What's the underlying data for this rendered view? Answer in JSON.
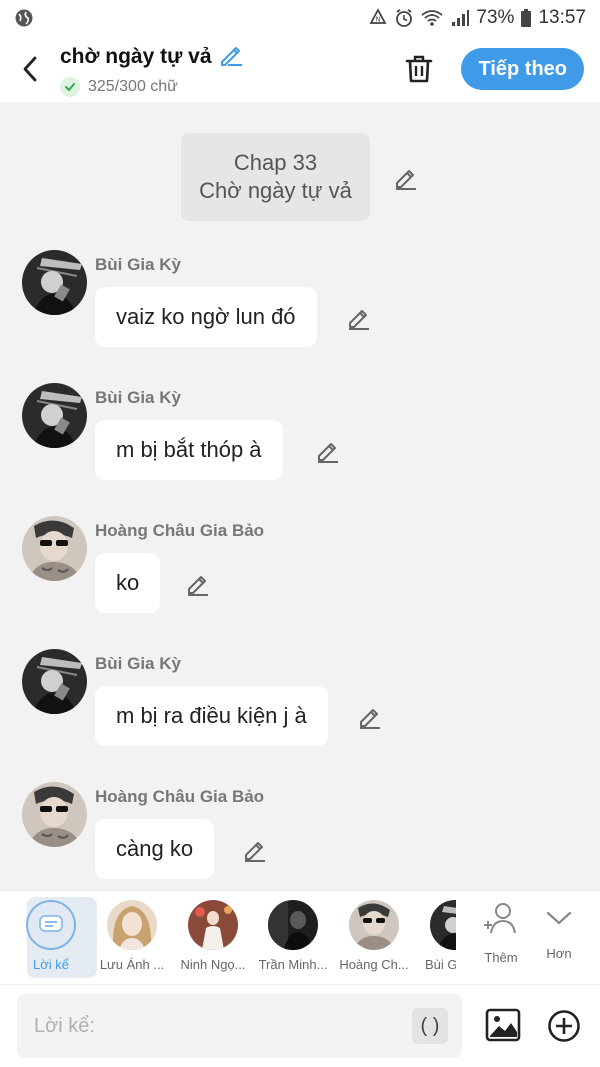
{
  "status_bar": {
    "battery": "73%",
    "time": "13:57"
  },
  "header": {
    "title": "chờ ngày tự vả",
    "word_count": "325/300 chữ",
    "next_label": "Tiếp theo",
    "accent_color": "#3f9be8"
  },
  "chapter": {
    "line1": "Chap 33",
    "line2": "Chờ ngày tự vả"
  },
  "messages": [
    {
      "name": "Bùi Gia Kỳ",
      "text": "vaiz ko ngờ lun đó"
    },
    {
      "name": "Bùi Gia Kỳ",
      "text": "m bị bắt thóp à"
    },
    {
      "name": "Hoàng Châu Gia Bảo",
      "text": "ko"
    },
    {
      "name": "Bùi Gia Kỳ",
      "text": "m bị ra điều kiện j à"
    },
    {
      "name": "Hoàng Châu Gia Bảo",
      "text": "càng ko"
    }
  ],
  "characters": [
    {
      "label": "Lời kể",
      "icon": "narration-icon",
      "selected": true
    },
    {
      "label": "Lưu Ánh ..."
    },
    {
      "label": "Ninh Ngọ..."
    },
    {
      "label": "Trần Minh..."
    },
    {
      "label": "Hoàng Ch..."
    },
    {
      "label": "Bùi G"
    }
  ],
  "char_actions": {
    "add_label": "Thêm",
    "more_label": "Hơn"
  },
  "input": {
    "placeholder": "Lời kể:",
    "paren_label": "( )"
  },
  "icons": [
    "back-icon",
    "pencil-icon",
    "check-icon",
    "trash-icon",
    "image-icon",
    "plus-circle-icon",
    "add-person-icon",
    "chevron-down-icon"
  ]
}
